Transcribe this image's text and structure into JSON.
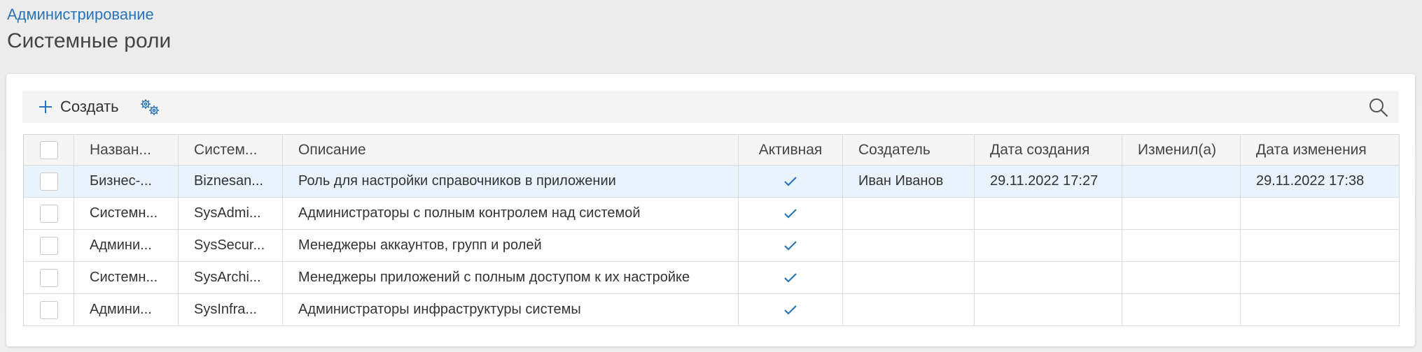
{
  "breadcrumb": "Администрирование",
  "page_title": "Системные роли",
  "toolbar": {
    "create_label": "Создать"
  },
  "table": {
    "columns": [
      "Назван...",
      "Систем...",
      "Описание",
      "Активная",
      "Создатель",
      "Дата создания",
      "Изменил(а)",
      "Дата изменения"
    ],
    "rows": [
      {
        "name": "Бизнес-...",
        "system_name": "Biznesan...",
        "description": "Роль для настройки справочников в приложении",
        "active": true,
        "creator": "Иван Иванов",
        "created": "29.11.2022 17:27",
        "modified_by": "",
        "modified": "29.11.2022 17:38"
      },
      {
        "name": "Системн...",
        "system_name": "SysAdmi...",
        "description": "Администраторы с полным контролем над системой",
        "active": true,
        "creator": "",
        "created": "",
        "modified_by": "",
        "modified": ""
      },
      {
        "name": "Админи...",
        "system_name": "SysSecur...",
        "description": "Менеджеры аккаунтов, групп и ролей",
        "active": true,
        "creator": "",
        "created": "",
        "modified_by": "",
        "modified": ""
      },
      {
        "name": "Системн...",
        "system_name": "SysArchi...",
        "description": "Менеджеры приложений с полным доступом к их настройке",
        "active": true,
        "creator": "",
        "created": "",
        "modified_by": "",
        "modified": ""
      },
      {
        "name": "Админи...",
        "system_name": "SysInfra...",
        "description": "Администраторы инфраструктуры системы",
        "active": true,
        "creator": "",
        "created": "",
        "modified_by": "",
        "modified": ""
      }
    ]
  },
  "icons": {
    "create": "plus-icon",
    "settings": "gears-icon",
    "search": "search-icon",
    "active": "check-icon"
  },
  "colors": {
    "accent": "#2a74b8",
    "selected_row": "#e8f3fc"
  }
}
